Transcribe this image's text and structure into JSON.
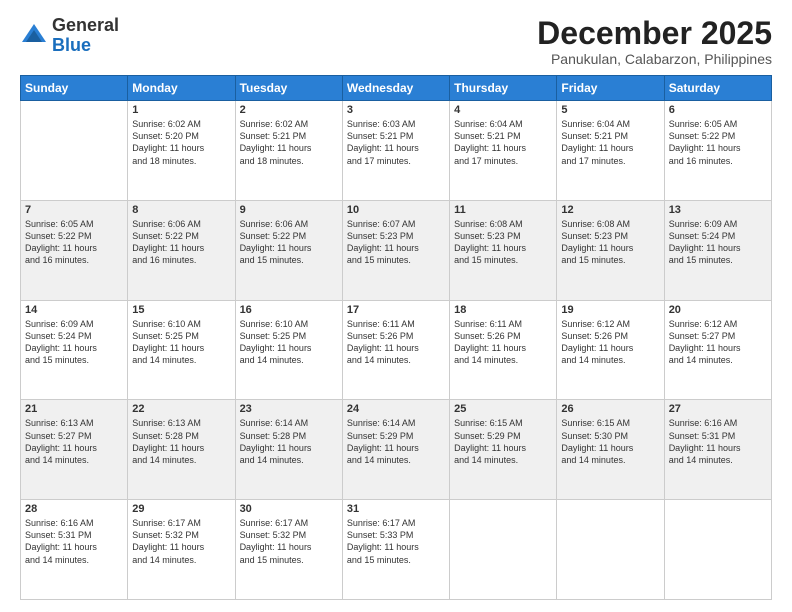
{
  "logo": {
    "general": "General",
    "blue": "Blue"
  },
  "header": {
    "month": "December 2025",
    "location": "Panukulan, Calabarzon, Philippines"
  },
  "weekdays": [
    "Sunday",
    "Monday",
    "Tuesday",
    "Wednesday",
    "Thursday",
    "Friday",
    "Saturday"
  ],
  "weeks": [
    [
      {
        "day": "",
        "info": ""
      },
      {
        "day": "1",
        "info": "Sunrise: 6:02 AM\nSunset: 5:20 PM\nDaylight: 11 hours\nand 18 minutes."
      },
      {
        "day": "2",
        "info": "Sunrise: 6:02 AM\nSunset: 5:21 PM\nDaylight: 11 hours\nand 18 minutes."
      },
      {
        "day": "3",
        "info": "Sunrise: 6:03 AM\nSunset: 5:21 PM\nDaylight: 11 hours\nand 17 minutes."
      },
      {
        "day": "4",
        "info": "Sunrise: 6:04 AM\nSunset: 5:21 PM\nDaylight: 11 hours\nand 17 minutes."
      },
      {
        "day": "5",
        "info": "Sunrise: 6:04 AM\nSunset: 5:21 PM\nDaylight: 11 hours\nand 17 minutes."
      },
      {
        "day": "6",
        "info": "Sunrise: 6:05 AM\nSunset: 5:22 PM\nDaylight: 11 hours\nand 16 minutes."
      }
    ],
    [
      {
        "day": "7",
        "info": "Sunrise: 6:05 AM\nSunset: 5:22 PM\nDaylight: 11 hours\nand 16 minutes."
      },
      {
        "day": "8",
        "info": "Sunrise: 6:06 AM\nSunset: 5:22 PM\nDaylight: 11 hours\nand 16 minutes."
      },
      {
        "day": "9",
        "info": "Sunrise: 6:06 AM\nSunset: 5:22 PM\nDaylight: 11 hours\nand 15 minutes."
      },
      {
        "day": "10",
        "info": "Sunrise: 6:07 AM\nSunset: 5:23 PM\nDaylight: 11 hours\nand 15 minutes."
      },
      {
        "day": "11",
        "info": "Sunrise: 6:08 AM\nSunset: 5:23 PM\nDaylight: 11 hours\nand 15 minutes."
      },
      {
        "day": "12",
        "info": "Sunrise: 6:08 AM\nSunset: 5:23 PM\nDaylight: 11 hours\nand 15 minutes."
      },
      {
        "day": "13",
        "info": "Sunrise: 6:09 AM\nSunset: 5:24 PM\nDaylight: 11 hours\nand 15 minutes."
      }
    ],
    [
      {
        "day": "14",
        "info": "Sunrise: 6:09 AM\nSunset: 5:24 PM\nDaylight: 11 hours\nand 15 minutes."
      },
      {
        "day": "15",
        "info": "Sunrise: 6:10 AM\nSunset: 5:25 PM\nDaylight: 11 hours\nand 14 minutes."
      },
      {
        "day": "16",
        "info": "Sunrise: 6:10 AM\nSunset: 5:25 PM\nDaylight: 11 hours\nand 14 minutes."
      },
      {
        "day": "17",
        "info": "Sunrise: 6:11 AM\nSunset: 5:26 PM\nDaylight: 11 hours\nand 14 minutes."
      },
      {
        "day": "18",
        "info": "Sunrise: 6:11 AM\nSunset: 5:26 PM\nDaylight: 11 hours\nand 14 minutes."
      },
      {
        "day": "19",
        "info": "Sunrise: 6:12 AM\nSunset: 5:26 PM\nDaylight: 11 hours\nand 14 minutes."
      },
      {
        "day": "20",
        "info": "Sunrise: 6:12 AM\nSunset: 5:27 PM\nDaylight: 11 hours\nand 14 minutes."
      }
    ],
    [
      {
        "day": "21",
        "info": "Sunrise: 6:13 AM\nSunset: 5:27 PM\nDaylight: 11 hours\nand 14 minutes."
      },
      {
        "day": "22",
        "info": "Sunrise: 6:13 AM\nSunset: 5:28 PM\nDaylight: 11 hours\nand 14 minutes."
      },
      {
        "day": "23",
        "info": "Sunrise: 6:14 AM\nSunset: 5:28 PM\nDaylight: 11 hours\nand 14 minutes."
      },
      {
        "day": "24",
        "info": "Sunrise: 6:14 AM\nSunset: 5:29 PM\nDaylight: 11 hours\nand 14 minutes."
      },
      {
        "day": "25",
        "info": "Sunrise: 6:15 AM\nSunset: 5:29 PM\nDaylight: 11 hours\nand 14 minutes."
      },
      {
        "day": "26",
        "info": "Sunrise: 6:15 AM\nSunset: 5:30 PM\nDaylight: 11 hours\nand 14 minutes."
      },
      {
        "day": "27",
        "info": "Sunrise: 6:16 AM\nSunset: 5:31 PM\nDaylight: 11 hours\nand 14 minutes."
      }
    ],
    [
      {
        "day": "28",
        "info": "Sunrise: 6:16 AM\nSunset: 5:31 PM\nDaylight: 11 hours\nand 14 minutes."
      },
      {
        "day": "29",
        "info": "Sunrise: 6:17 AM\nSunset: 5:32 PM\nDaylight: 11 hours\nand 14 minutes."
      },
      {
        "day": "30",
        "info": "Sunrise: 6:17 AM\nSunset: 5:32 PM\nDaylight: 11 hours\nand 15 minutes."
      },
      {
        "day": "31",
        "info": "Sunrise: 6:17 AM\nSunset: 5:33 PM\nDaylight: 11 hours\nand 15 minutes."
      },
      {
        "day": "",
        "info": ""
      },
      {
        "day": "",
        "info": ""
      },
      {
        "day": "",
        "info": ""
      }
    ]
  ]
}
